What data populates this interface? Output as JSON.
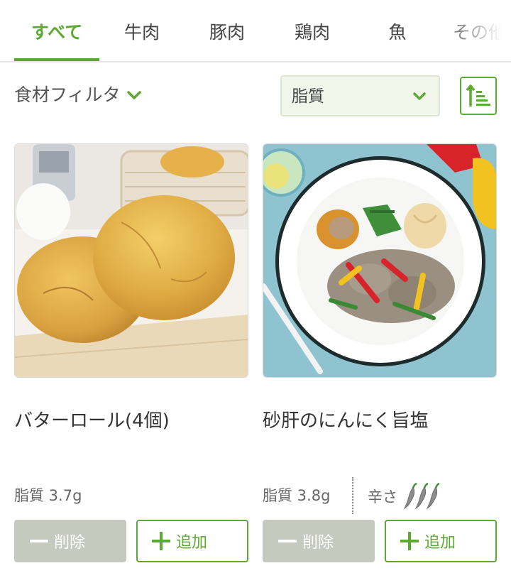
{
  "tabs": [
    {
      "label": "すべて",
      "active": true
    },
    {
      "label": "牛肉",
      "active": false
    },
    {
      "label": "豚肉",
      "active": false
    },
    {
      "label": "鶏肉",
      "active": false
    },
    {
      "label": "魚",
      "active": false
    },
    {
      "label": "その他",
      "active": false
    }
  ],
  "filter": {
    "label": "食材フィルタ",
    "icon": "chevron-down-icon"
  },
  "sort": {
    "selected": "脂質",
    "order_icon": "sort-ascending-icon"
  },
  "colors": {
    "accent": "#5ea934",
    "delete_bg": "#c6c9bd",
    "select_bg": "#f1f5ea"
  },
  "items": [
    {
      "name": "バターロール(4個)",
      "nutrient": "脂質 3.7g",
      "image": "butter-rolls-photo",
      "delete_label": "削除",
      "add_label": "追加"
    },
    {
      "name": "砂肝のにんにく旨塩",
      "nutrient": "脂質 3.8g",
      "spicy_label": "辛さ",
      "spicy_level": 3,
      "image": "gizzard-plate-photo",
      "delete_label": "削除",
      "add_label": "追加"
    }
  ]
}
